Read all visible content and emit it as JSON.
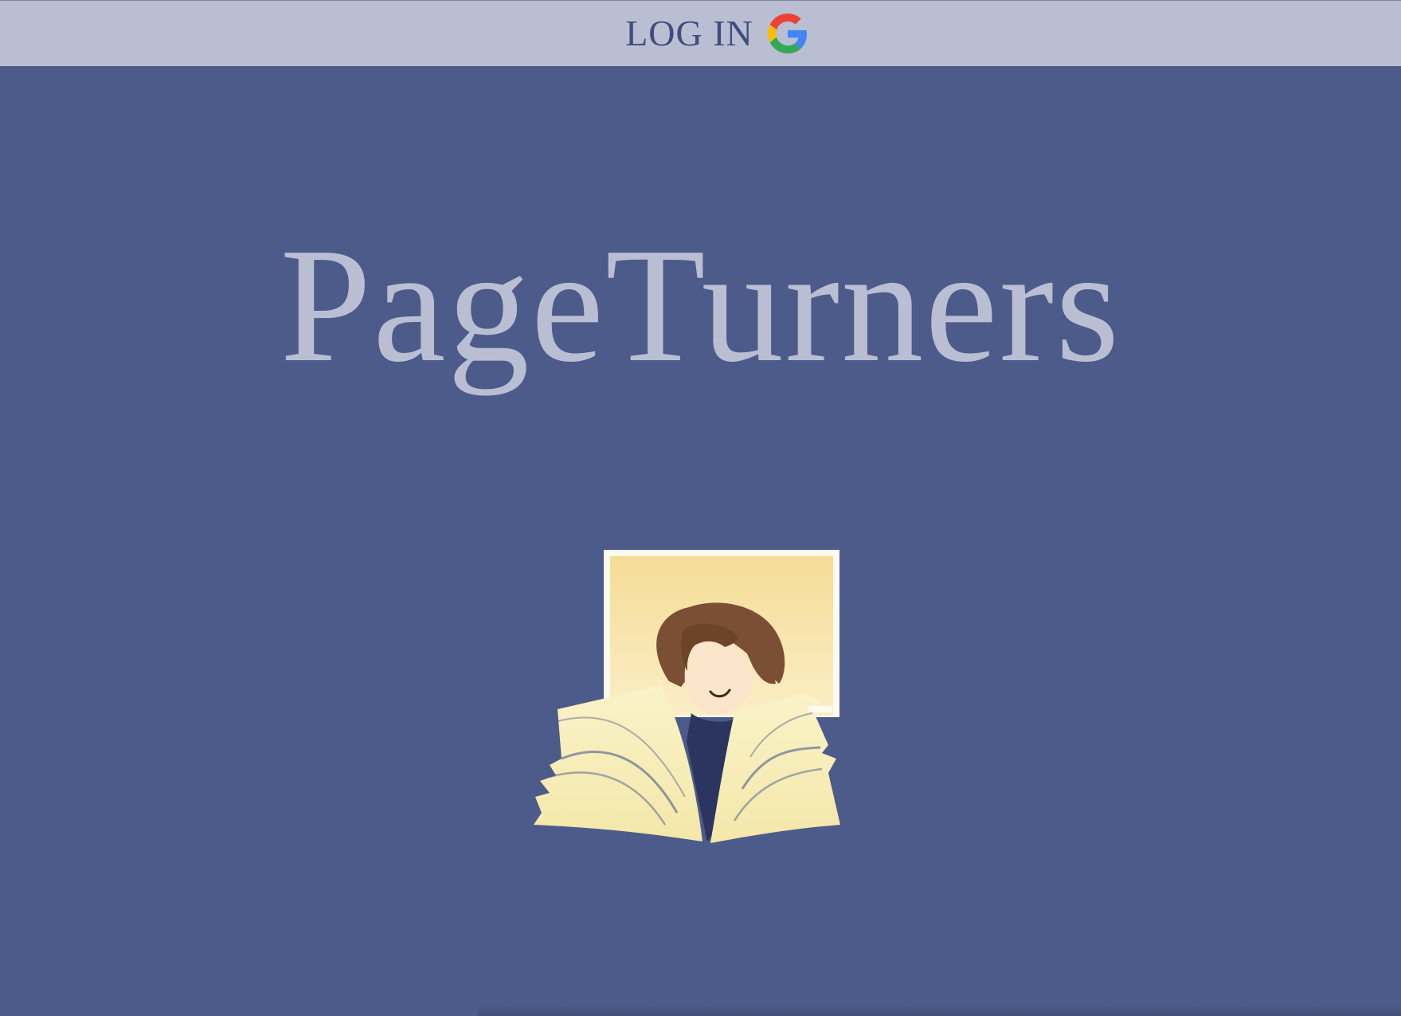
{
  "header": {
    "login_label": "LOG IN",
    "login_icon": "google-icon"
  },
  "hero": {
    "title": "PageTurners",
    "illustration": "reader-with-open-book-illustration"
  },
  "colors": {
    "background": "#4c5b89",
    "header_bar": "#b9bed3",
    "title_text": "#b9bed3",
    "login_text": "#3f4d7c"
  }
}
